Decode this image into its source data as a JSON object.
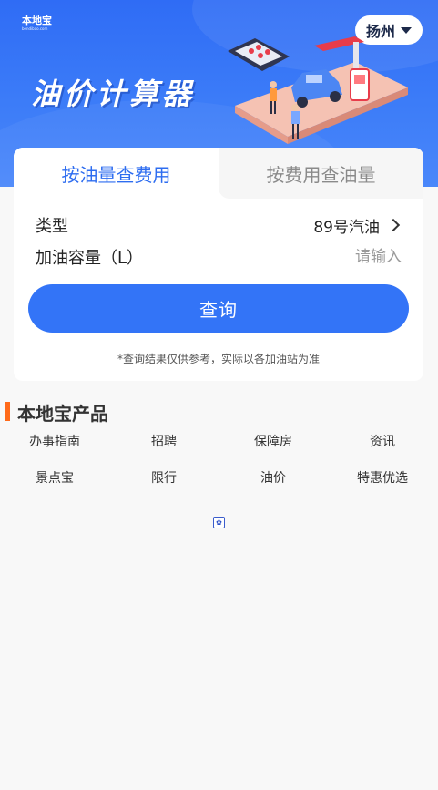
{
  "header": {
    "logo_text": "本地宝",
    "logo_sub": "bendibao.com",
    "city": "扬州",
    "title": "油价计算器"
  },
  "tabs": [
    {
      "label": "按油量查费用",
      "active": true
    },
    {
      "label": "按费用查油量",
      "active": false
    }
  ],
  "form": {
    "type_label": "类型",
    "type_value": "89号汽油",
    "volume_label": "加油容量（L）",
    "volume_placeholder": "请输入",
    "volume_value": ""
  },
  "query_button": "查询",
  "note": "*查询结果仅供参考，实际以各加油站为准",
  "products": {
    "title": "本地宝产品",
    "items": [
      "办事指南",
      "招聘",
      "保障房",
      "资讯",
      "景点宝",
      "限行",
      "油价",
      "特惠优选"
    ]
  },
  "colors": {
    "primary": "#3374f7",
    "accent": "#ff6a1a",
    "header_bg": "#3c7cf8"
  }
}
